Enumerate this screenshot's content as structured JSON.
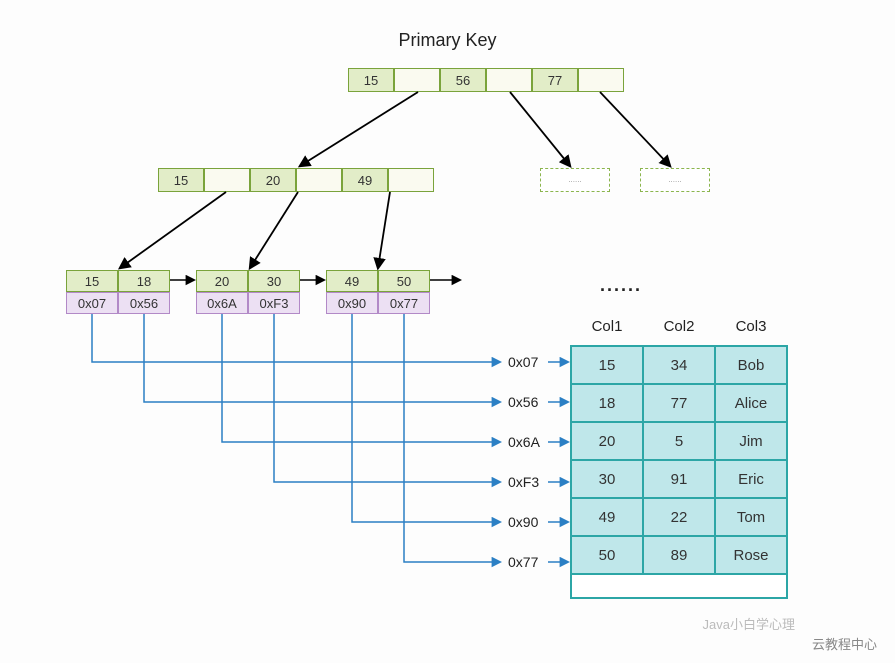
{
  "title": "Primary Key",
  "root": {
    "keys": [
      "15",
      "56",
      "77"
    ]
  },
  "internal": {
    "keys": [
      "15",
      "20",
      "49"
    ]
  },
  "leaves": [
    {
      "keys": [
        "15",
        "18"
      ],
      "ptrs": [
        "0x07",
        "0x56"
      ]
    },
    {
      "keys": [
        "20",
        "30"
      ],
      "ptrs": [
        "0x6A",
        "0xF3"
      ]
    },
    {
      "keys": [
        "49",
        "50"
      ],
      "ptrs": [
        "0x90",
        "0x77"
      ]
    }
  ],
  "addrs": [
    "0x07",
    "0x56",
    "0x6A",
    "0xF3",
    "0x90",
    "0x77"
  ],
  "table": {
    "headers": [
      "Col1",
      "Col2",
      "Col3"
    ],
    "rows": [
      [
        "15",
        "34",
        "Bob"
      ],
      [
        "18",
        "77",
        "Alice"
      ],
      [
        "20",
        "5",
        "Jim"
      ],
      [
        "30",
        "91",
        "Eric"
      ],
      [
        "49",
        "22",
        "Tom"
      ],
      [
        "50",
        "89",
        "Rose"
      ]
    ]
  },
  "dots": "......",
  "footer_credit": "云教程中心",
  "watermark": "Java小白学心理"
}
